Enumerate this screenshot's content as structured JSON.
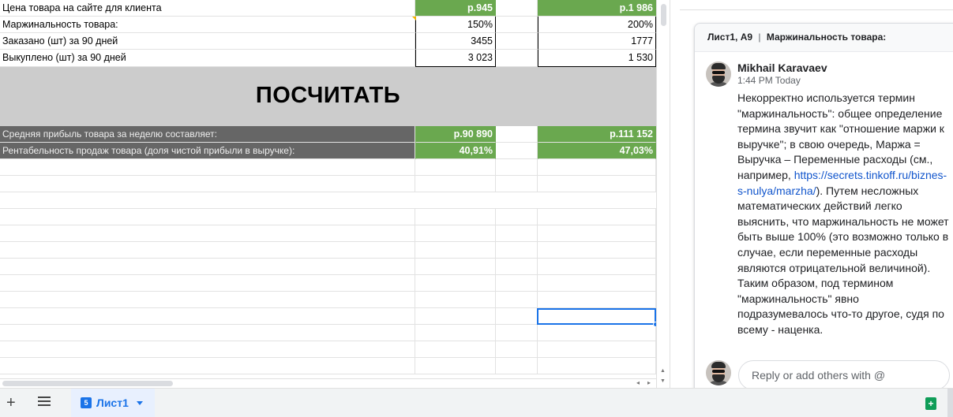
{
  "sheet": {
    "rows": [
      {
        "label": "Цена товара на сайте для клиента",
        "v1": "р.945",
        "v2": "р.1 986"
      },
      {
        "label": "Маржинальность товара:",
        "v1": "150%",
        "v2": "200%"
      },
      {
        "label": "Заказано (шт) за 90 дней",
        "v1": "3455",
        "v2": "1777"
      },
      {
        "label": "Выкуплено (шт) за 90 дней",
        "v1": "3 023",
        "v2": "1 530"
      }
    ],
    "calculate_label": "ПОСЧИТАТЬ",
    "results": [
      {
        "label": "Средняя прибыль товара за неделю составляет:",
        "v1": "р.90 890",
        "v2": "р.111 152"
      },
      {
        "label": "Рентабельность продаж товара (доля чистой прибыли в выручке):",
        "v1": "40,91%",
        "v2": "47,03%"
      }
    ],
    "colors": {
      "green": "#6aa84f",
      "dark": "#666666",
      "band": "#cccccc",
      "selection": "#1a73e8"
    }
  },
  "sheet_tabs": {
    "add": "+",
    "active": {
      "badge": "5",
      "name": "Лист1"
    }
  },
  "comment": {
    "ref": "Лист1, A9",
    "ref_sep": "|",
    "ref_text": "Маржинальность товара:",
    "author": "Mikhail Karavaev",
    "time": "1:44 PM Today",
    "body_part1": "Некорректно используется термин \"маржинальность\": общее определение термина звучит как \"отношение маржи к выручке\"; в свою очередь, Маржа = Выручка – Переменные расходы (см., например, ",
    "link": "https://secrets.tinkoff.ru/biznes-s-nulya/marzha/",
    "body_part2": "). Путем несложных математических действий легко выяснить, что маржинальность не может быть выше 100% (это возможно только в случае, если переменные расходы являются отрицательной величиной). Таким образом, под термином \"маржинальность\" явно подразумевалось что-то другое, судя по всему - наценка.",
    "reply_placeholder": "Reply or add others with @"
  }
}
